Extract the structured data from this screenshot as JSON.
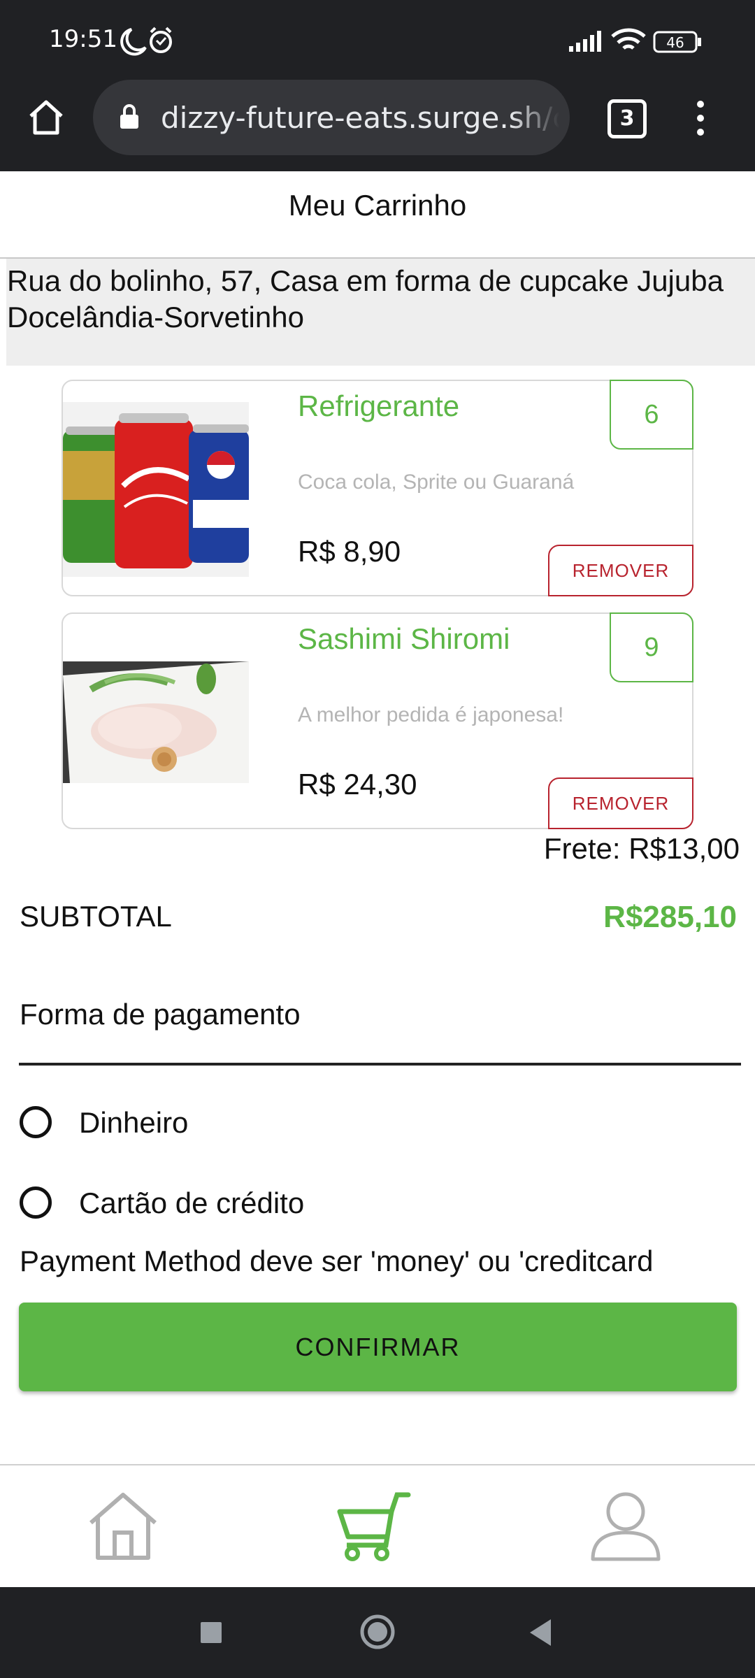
{
  "status_bar": {
    "time": "19:51",
    "battery": "46",
    "icons": [
      "moon-icon",
      "alarm-icon",
      "signal-icon",
      "wifi-icon",
      "battery-icon"
    ]
  },
  "browser": {
    "url": "dizzy-future-eats.surge.sh/ca",
    "tab_count": "3",
    "icons": [
      "home-icon",
      "lock-icon",
      "tabs-icon",
      "menu-icon"
    ]
  },
  "page": {
    "title": "Meu Carrinho"
  },
  "address": {
    "line1": "Rua do bolinho, 57, Casa em forma de cupcake Jujuba",
    "line2": "Docelândia-Sorvetinho"
  },
  "cart": {
    "items": [
      {
        "name": "Refrigerante",
        "description": "Coca cola, Sprite ou Guaraná",
        "price": "R$ 8,90",
        "quantity": "6",
        "remove_label": "REMOVER"
      },
      {
        "name": "Sashimi Shiromi",
        "description": "A melhor pedida é japonesa!",
        "price": "R$ 24,30",
        "quantity": "9",
        "remove_label": "REMOVER"
      }
    ],
    "shipping": "Frete: R$13,00",
    "subtotal_label": "SUBTOTAL",
    "subtotal_value": "R$285,10"
  },
  "payment": {
    "title": "Forma de pagamento",
    "options": [
      {
        "label": "Dinheiro",
        "selected": false
      },
      {
        "label": "Cartão de crédito",
        "selected": false
      }
    ],
    "error": "Payment Method deve ser 'money' ou 'creditcard",
    "confirm_label": "CONFIRMAR"
  },
  "bottom_nav": {
    "items": [
      {
        "icon": "home-icon",
        "active": false
      },
      {
        "icon": "cart-icon",
        "active": true
      },
      {
        "icon": "profile-icon",
        "active": false
      }
    ]
  },
  "colors": {
    "accent": "#5cb646",
    "danger": "#b8232e",
    "chrome": "#202124"
  }
}
